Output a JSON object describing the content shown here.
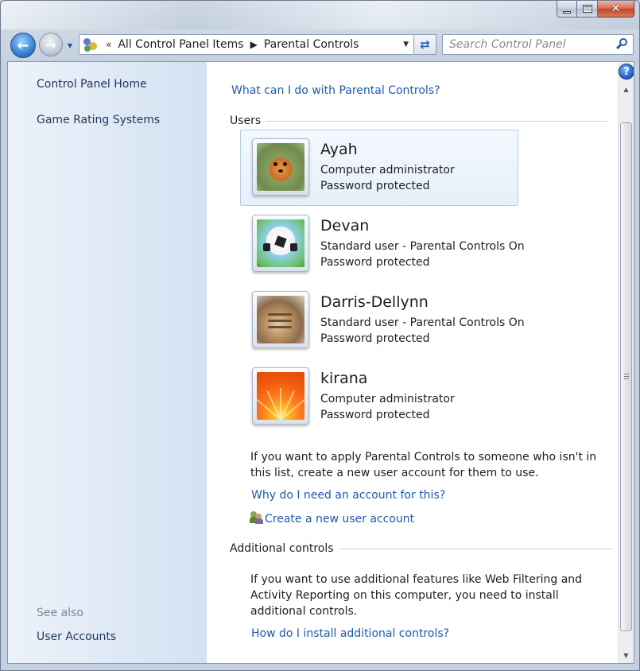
{
  "window": {
    "caption_close": "✕"
  },
  "nav": {
    "back_glyph": "←",
    "forward_glyph": "→",
    "refresh_glyph": "⇄"
  },
  "address": {
    "overflow": "«",
    "crumbs": [
      "All Control Panel Items",
      "Parental Controls"
    ]
  },
  "search": {
    "placeholder": "Search Control Panel"
  },
  "sidebar": {
    "links": [
      "Control Panel Home",
      "Game Rating Systems"
    ],
    "see_also_heading": "See also",
    "see_also_links": [
      "User Accounts"
    ]
  },
  "main": {
    "help_link": "What can I do with Parental Controls?",
    "users_heading": "Users",
    "users": [
      {
        "name": "Ayah",
        "type": "Computer administrator",
        "password": "Password protected",
        "avatar": "dog-avatar",
        "selected": true
      },
      {
        "name": "Devan",
        "type": "Standard user - Parental Controls On",
        "password": "Password protected",
        "avatar": "soccer-ball-avatar",
        "selected": false
      },
      {
        "name": "Darris-Dellynn",
        "type": "Standard user - Parental Controls On",
        "password": "Password protected",
        "avatar": "kitten-avatar",
        "selected": false
      },
      {
        "name": "kirana",
        "type": "Computer administrator",
        "password": "Password protected",
        "avatar": "flower-avatar",
        "selected": false
      }
    ],
    "new_account_text": "If you want to apply Parental Controls to someone who isn't in this list, create a new user account for them to use.",
    "why_link": "Why do I need an account for this?",
    "create_link": "Create a new user account",
    "additional_heading": "Additional controls",
    "additional_text": "If you want to use additional features like Web Filtering and Activity Reporting on this computer, you need to install additional controls.",
    "install_link": "How do I install additional controls?"
  },
  "help_glyph": "?",
  "colors": {
    "link": "#1e5aa8",
    "sidebar_link": "#1e395b",
    "selected_tile": "#e6f0fb"
  }
}
